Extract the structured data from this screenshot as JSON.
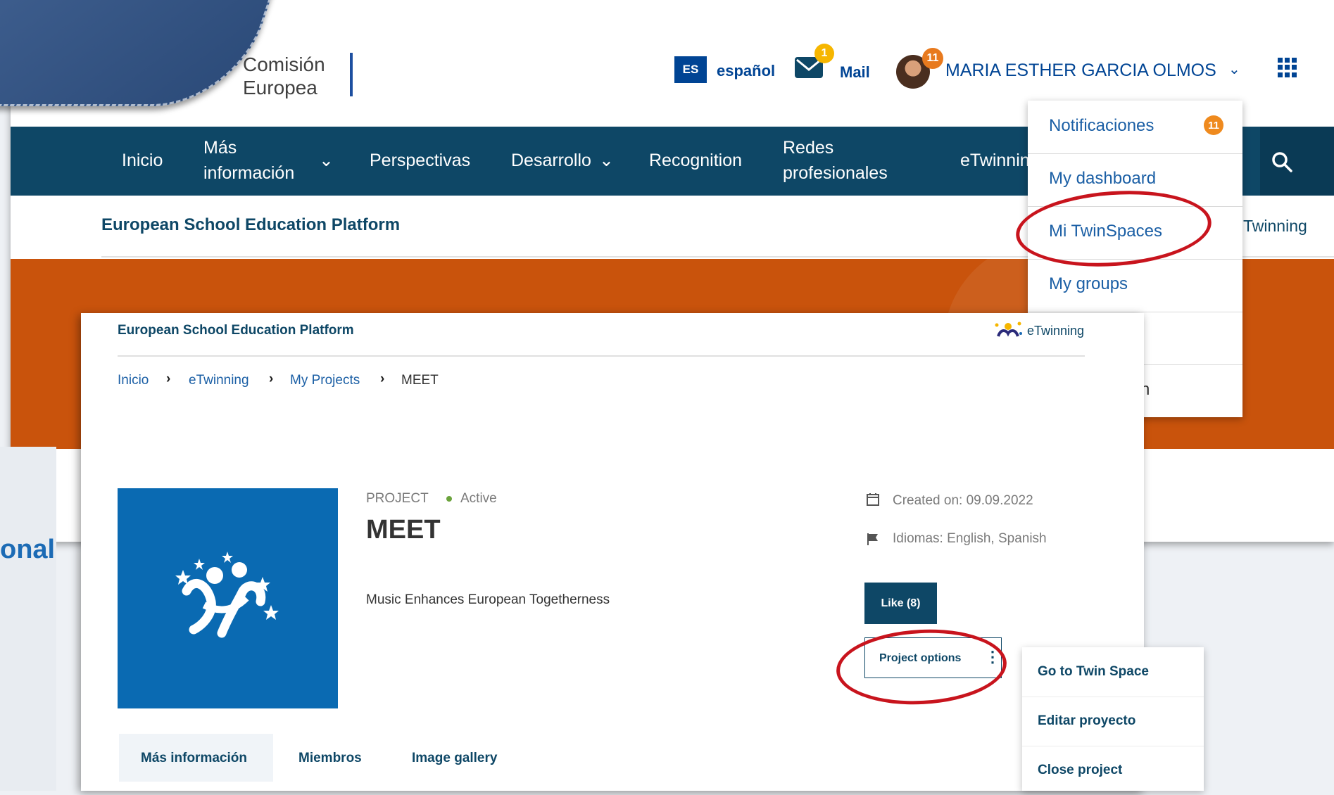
{
  "header": {
    "logo_line1": "Comisión",
    "logo_line2": "Europea",
    "lang_code": "ES",
    "lang_label": "español",
    "mail_count": "1",
    "mail_label": "Mail",
    "notif_count": "11",
    "user_name": "MARIA ESTHER GARCIA OLMOS"
  },
  "nav": {
    "inicio": "Inicio",
    "mas_line1": "Más",
    "mas_line2": "información",
    "perspectivas": "Perspectivas",
    "desarrollo": "Desarrollo",
    "recognition": "Recognition",
    "redes_line1": "Redes",
    "redes_line2": "profesionales",
    "etwinning": "eTwinnin"
  },
  "subheader": {
    "title": "European School Education Platform",
    "etwinning": "Twinning"
  },
  "user_menu": {
    "items": [
      {
        "label": "Notificaciones"
      },
      {
        "label": "My dashboard"
      },
      {
        "label": "Mi TwinSpaces"
      },
      {
        "label": "My groups"
      },
      {
        "label": ""
      },
      {
        "label": "n"
      }
    ],
    "notif_count": "11"
  },
  "left_fragment": {
    "text": "onal"
  },
  "project_page": {
    "title": "European School Education Platform",
    "etwinning_label": "eTwinning",
    "breadcrumb": [
      "Inicio",
      "eTwinning",
      "My Projects",
      "MEET"
    ],
    "kind": "PROJECT",
    "status": "Active",
    "name": "MEET",
    "description": "Music Enhances European Togetherness",
    "created": "Created on: 09.09.2022",
    "languages": "Idiomas: English, Spanish",
    "like_label": "Like (8)",
    "options_label": "Project options",
    "options_menu": [
      "Go to Twin Space",
      "Editar proyecto",
      "Close project"
    ],
    "tabs": [
      "Más información",
      "Miembros",
      "Image gallery"
    ]
  },
  "colors": {
    "navbar": "#0e4766",
    "banner": "#c9530c",
    "accent_blue": "#004494",
    "annotation_red": "#c8141d",
    "badge_orange": "#ef8a1e"
  }
}
